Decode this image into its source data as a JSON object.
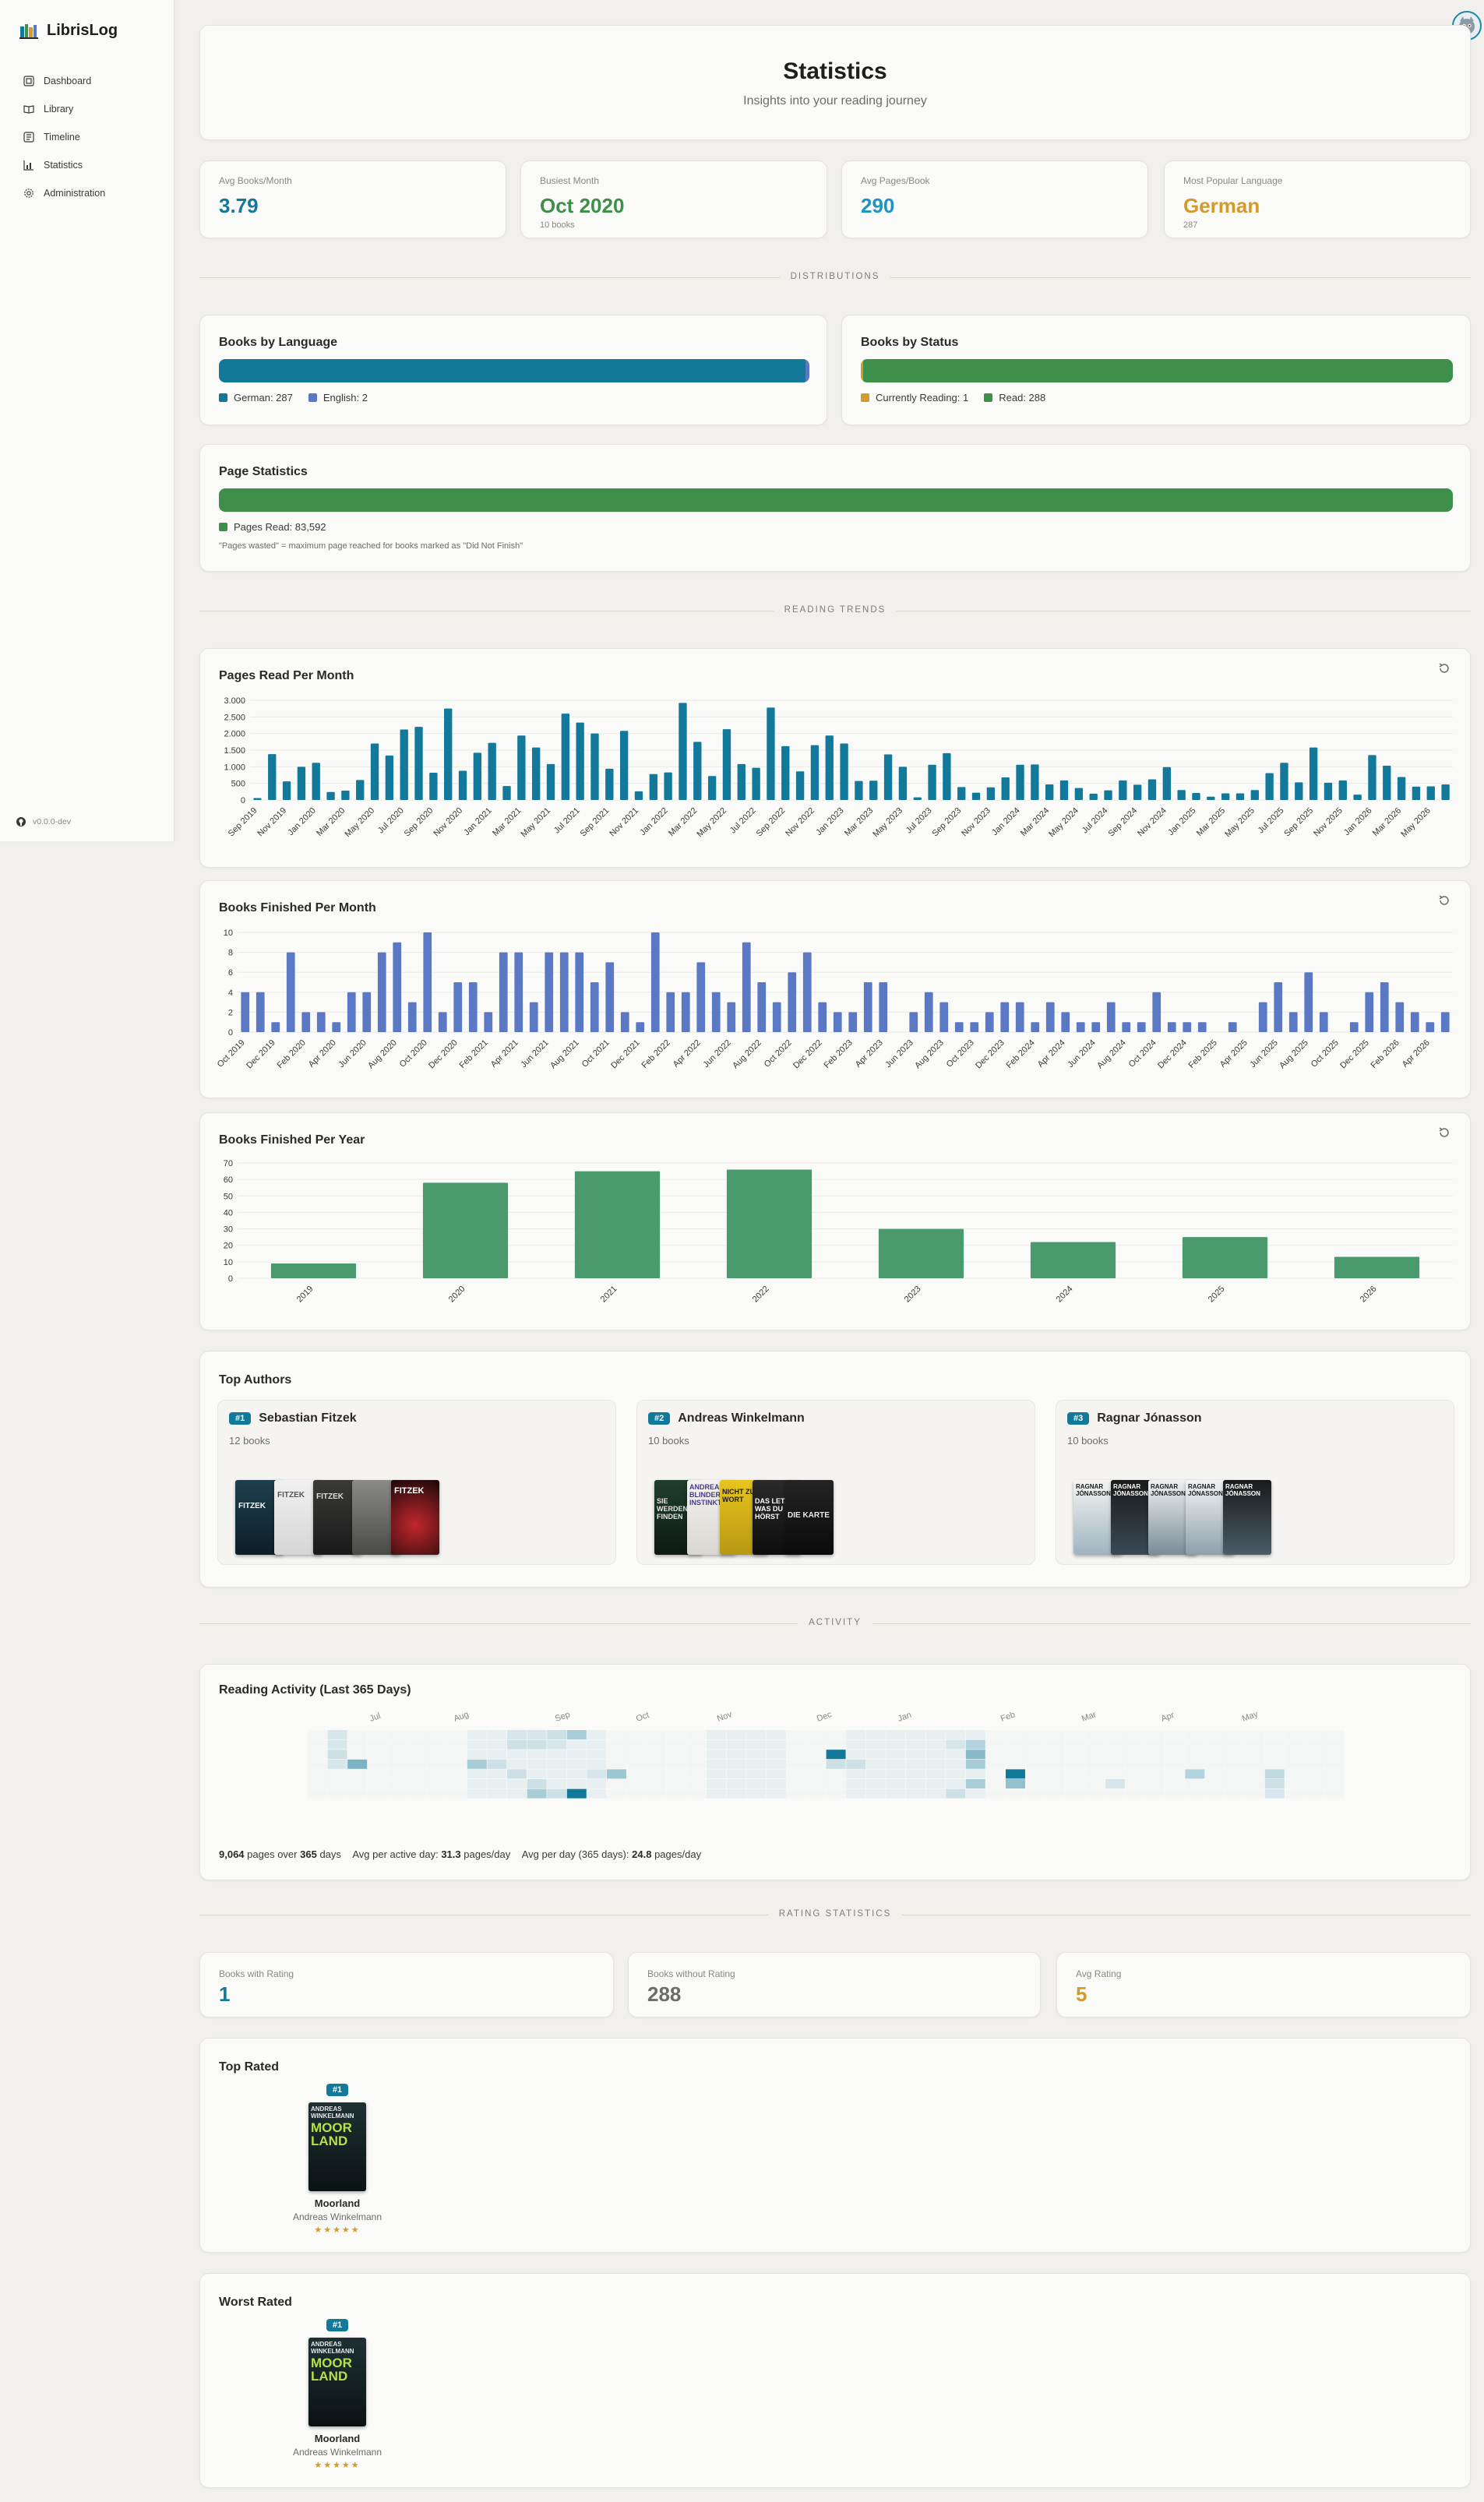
{
  "app": {
    "name": "LibrisLog",
    "version": "v0.0.0-dev"
  },
  "nav": [
    {
      "label": "Dashboard",
      "icon": "dashboard-icon"
    },
    {
      "label": "Library",
      "icon": "book-open-icon"
    },
    {
      "label": "Timeline",
      "icon": "timeline-icon"
    },
    {
      "label": "Statistics",
      "icon": "bar-chart-icon"
    },
    {
      "label": "Administration",
      "icon": "gear-icon"
    }
  ],
  "header": {
    "title": "Statistics",
    "subtitle": "Insights into your reading journey"
  },
  "summary": [
    {
      "label": "Avg Books/Month",
      "value": "3.79",
      "sub": "",
      "color": "#12799b"
    },
    {
      "label": "Busiest Month",
      "value": "Oct 2020",
      "sub": "10 books",
      "color": "#3d8f4a"
    },
    {
      "label": "Avg Pages/Book",
      "value": "290",
      "sub": "",
      "color": "#1a95c4"
    },
    {
      "label": "Most Popular Language",
      "value": "German",
      "sub": "287",
      "color": "#d49a2a"
    }
  ],
  "sections": {
    "distributions": "DISTRIBUTIONS",
    "trends": "READING TRENDS",
    "activity": "ACTIVITY",
    "rating": "RATING STATISTICS"
  },
  "language": {
    "title": "Books by Language",
    "items": [
      {
        "label": "German: 287",
        "value": 287,
        "color": "#12799b"
      },
      {
        "label": "English: 2",
        "value": 2,
        "color": "#5b78c4"
      }
    ]
  },
  "status": {
    "title": "Books by Status",
    "items": [
      {
        "label": "Currently Reading: 1",
        "value": 1,
        "color": "#d49a2a"
      },
      {
        "label": "Read: 288",
        "value": 288,
        "color": "#3d8f4a"
      }
    ]
  },
  "pages": {
    "title": "Page Statistics",
    "legend": "Pages Read: 83,592",
    "color": "#3d8f4a",
    "note": "\"Pages wasted\" = maximum page reached for books marked as \"Did Not Finish\""
  },
  "charts": {
    "pages_title": "Pages Read Per Month",
    "books_month_title": "Books Finished Per Month",
    "books_year_title": "Books Finished Per Year"
  },
  "chart_data": [
    {
      "type": "bar",
      "title": "Pages Read Per Month",
      "color": "#12799b",
      "ylim": [
        0,
        3000
      ],
      "yticks": [
        "0",
        "500",
        "1.000",
        "1.500",
        "2.000",
        "2.500",
        "3.000"
      ],
      "tick_step": 2,
      "categories": [
        "Sep 2019",
        "Oct 2019",
        "Nov 2019",
        "Dec 2019",
        "Jan 2020",
        "Feb 2020",
        "Mar 2020",
        "Apr 2020",
        "May 2020",
        "Jun 2020",
        "Jul 2020",
        "Aug 2020",
        "Sep 2020",
        "Oct 2020",
        "Nov 2020",
        "Dec 2020",
        "Jan 2021",
        "Feb 2021",
        "Mar 2021",
        "Apr 2021",
        "May 2021",
        "Jun 2021",
        "Jul 2021",
        "Aug 2021",
        "Sep 2021",
        "Oct 2021",
        "Nov 2021",
        "Dec 2021",
        "Jan 2022",
        "Feb 2022",
        "Mar 2022",
        "Apr 2022",
        "May 2022",
        "Jun 2022",
        "Jul 2022",
        "Aug 2022",
        "Sep 2022",
        "Oct 2022",
        "Nov 2022",
        "Dec 2022",
        "Jan 2023",
        "Feb 2023",
        "Mar 2023",
        "Apr 2023",
        "May 2023",
        "Jun 2023",
        "Jul 2023",
        "Aug 2023",
        "Sep 2023",
        "Oct 2023",
        "Nov 2023",
        "Dec 2023",
        "Jan 2024",
        "Feb 2024",
        "Mar 2024",
        "Apr 2024",
        "May 2024",
        "Jun 2024",
        "Jul 2024",
        "Aug 2024",
        "Sep 2024",
        "Oct 2024",
        "Nov 2024",
        "Dec 2024",
        "Jan 2025",
        "Feb 2025",
        "Mar 2025",
        "Apr 2025",
        "May 2025",
        "Jun 2025",
        "Jul 2025",
        "Aug 2025",
        "Sep 2025",
        "Oct 2025",
        "Nov 2025",
        "Dec 2025",
        "Jan 2026",
        "Feb 2026",
        "Mar 2026",
        "Apr 2026",
        "May 2026"
      ],
      "values": [
        60,
        1380,
        560,
        1000,
        1120,
        240,
        280,
        600,
        1700,
        1340,
        2120,
        2200,
        820,
        2750,
        880,
        1420,
        1720,
        420,
        1940,
        1580,
        1080,
        2600,
        2330,
        2000,
        940,
        2080,
        260,
        780,
        830,
        2920,
        1750,
        720,
        2130,
        1080,
        970,
        2780,
        1620,
        860,
        1650,
        1940,
        1700,
        570,
        580,
        1370,
        1000,
        80,
        1060,
        1410,
        390,
        220,
        380,
        680,
        1060,
        1070,
        470,
        590,
        360,
        190,
        290,
        590,
        460,
        620,
        990,
        300,
        210,
        100,
        200,
        200,
        300,
        810,
        1120,
        530,
        1580,
        520,
        590,
        160,
        1350,
        1030,
        690,
        400,
        410,
        470
      ]
    },
    {
      "type": "bar",
      "title": "Books Finished Per Month",
      "color": "#5b78c4",
      "ylim": [
        0,
        10
      ],
      "yticks": [
        "0",
        "2",
        "4",
        "6",
        "8",
        "10"
      ],
      "tick_step": 2,
      "categories": [
        "Oct 2019",
        "Nov 2019",
        "Dec 2019",
        "Jan 2020",
        "Feb 2020",
        "Mar 2020",
        "Apr 2020",
        "May 2020",
        "Jun 2020",
        "Jul 2020",
        "Aug 2020",
        "Sep 2020",
        "Oct 2020",
        "Nov 2020",
        "Dec 2020",
        "Jan 2021",
        "Feb 2021",
        "Mar 2021",
        "Apr 2021",
        "May 2021",
        "Jun 2021",
        "Jul 2021",
        "Aug 2021",
        "Sep 2021",
        "Oct 2021",
        "Nov 2021",
        "Dec 2021",
        "Jan 2022",
        "Feb 2022",
        "Mar 2022",
        "Apr 2022",
        "May 2022",
        "Jun 2022",
        "Jul 2022",
        "Aug 2022",
        "Sep 2022",
        "Oct 2022",
        "Nov 2022",
        "Dec 2022",
        "Jan 2023",
        "Feb 2023",
        "Mar 2023",
        "Apr 2023",
        "May 2023",
        "Jun 2023",
        "Jul 2023",
        "Aug 2023",
        "Sep 2023",
        "Oct 2023",
        "Nov 2023",
        "Dec 2023",
        "Jan 2024",
        "Feb 2024",
        "Mar 2024",
        "Apr 2024",
        "May 2024",
        "Jun 2024",
        "Jul 2024",
        "Aug 2024",
        "Sep 2024",
        "Oct 2024",
        "Nov 2024",
        "Dec 2024",
        "Jan 2025",
        "Feb 2025",
        "Mar 2025",
        "Apr 2025",
        "May 2025",
        "Jun 2025",
        "Jul 2025",
        "Aug 2025",
        "Sep 2025",
        "Oct 2025",
        "Nov 2025",
        "Dec 2025",
        "Jan 2026",
        "Feb 2026",
        "Mar 2026",
        "Apr 2026",
        "May 2026"
      ],
      "values": [
        4,
        4,
        1,
        8,
        2,
        2,
        1,
        4,
        4,
        8,
        9,
        3,
        10,
        2,
        5,
        5,
        2,
        8,
        8,
        3,
        8,
        8,
        8,
        5,
        7,
        2,
        1,
        10,
        4,
        4,
        7,
        4,
        3,
        9,
        5,
        3,
        6,
        8,
        3,
        2,
        2,
        5,
        5,
        0,
        2,
        4,
        3,
        1,
        1,
        2,
        3,
        3,
        1,
        3,
        2,
        1,
        1,
        3,
        1,
        1,
        4,
        1,
        1,
        1,
        0,
        1,
        0,
        3,
        5,
        2,
        6,
        2,
        0,
        1,
        4,
        5,
        3,
        2,
        1,
        2
      ]
    },
    {
      "type": "bar",
      "title": "Books Finished Per Year",
      "color": "#4a9a6e",
      "ylim": [
        0,
        70
      ],
      "yticks": [
        "0",
        "10",
        "20",
        "30",
        "40",
        "50",
        "60",
        "70"
      ],
      "tick_step": 1,
      "categories": [
        "2019",
        "2020",
        "2021",
        "2022",
        "2023",
        "2024",
        "2025",
        "2026"
      ],
      "values": [
        9,
        58,
        65,
        66,
        30,
        22,
        25,
        13
      ]
    }
  ],
  "authors": {
    "title": "Top Authors",
    "items": [
      {
        "rank": "#1",
        "name": "Sebastian Fitzek",
        "count": "12 books",
        "cover_texts": [
          "FITZEK",
          "FITZEK",
          "FITZEK",
          "",
          "FITZEK"
        ]
      },
      {
        "rank": "#2",
        "name": "Andreas Winkelmann",
        "count": "10 books",
        "cover_texts": [
          "SIE WERDEN FINDEN",
          "ANDREAS BLINDER INSTINKT",
          "NICHT ZUM WORT",
          "DAS LETZTE WAS DU HÖRST",
          "DIE KARTE"
        ]
      },
      {
        "rank": "#3",
        "name": "Ragnar Jónasson",
        "count": "10 books",
        "cover_texts": [
          "RAGNAR JÓNASSON",
          "RAGNAR JÓNASSON",
          "RAGNAR JÓNASSON",
          "RAGNAR JÓNASSON",
          "RAGNAR JÓNASSON"
        ]
      }
    ]
  },
  "activity": {
    "title": "Reading Activity (Last 365 Days)",
    "months": [
      "Jul",
      "Aug",
      "Sep",
      "Oct",
      "Nov",
      "Dec",
      "Jan",
      "Feb",
      "Mar",
      "Apr",
      "May"
    ],
    "stat_pages": "9,064",
    "stat_pages_text": "pages over",
    "stat_days": "365",
    "stat_days_text": "days",
    "avg_active_label": "Avg per active day:",
    "avg_active_value": "31.3",
    "avg_day_label": "Avg per day (365 days):",
    "avg_day_value": "24.8",
    "unit": "pages/day"
  },
  "rating_summary": [
    {
      "label": "Books with Rating",
      "value": "1",
      "color": "#12799b"
    },
    {
      "label": "Books without Rating",
      "value": "288",
      "color": "#6e6c68"
    },
    {
      "label": "Avg Rating",
      "value": "5",
      "color": "#d49a2a"
    }
  ],
  "top_rated": {
    "title": "Top Rated",
    "rank": "#1",
    "book": "Moorland",
    "author": "Andreas Winkelmann",
    "stars": "★★★★★",
    "cover_author": "ANDREAS WINKELMANN",
    "cover_title": "MOOR LAND"
  },
  "worst_rated": {
    "title": "Worst Rated",
    "rank": "#1",
    "book": "Moorland",
    "author": "Andreas Winkelmann",
    "stars": "★★★★★",
    "cover_author": "ANDREAS WINKELMANN",
    "cover_title": "MOOR LAND"
  }
}
